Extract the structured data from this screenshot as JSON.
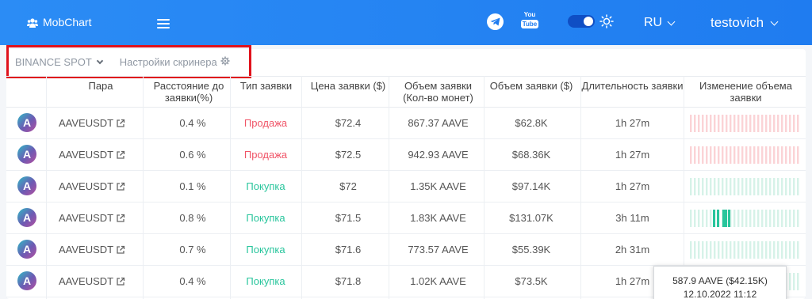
{
  "header": {
    "brand": "MobChart",
    "language": "RU",
    "username": "testovich"
  },
  "toolbar": {
    "exchange": "BINANCE SPOT",
    "settings_label": "Настройки скринера"
  },
  "table": {
    "columns": [
      "Пара",
      "Расстояние до заявки(%)",
      "Тип заявки",
      "Цена заявки ($)",
      "Объем заявки (Кол-во монет)",
      "Объем заявки ($)",
      "Длительность заявки",
      "Изменение объема заявки"
    ],
    "rows": [
      {
        "coin": "A",
        "pair": "AAVEUSDT",
        "distance": "0.4 %",
        "type": "Продажа",
        "side": "sell",
        "price": "$72.4",
        "volume_coins": "867.37 AAVE",
        "volume_usd": "$62.8K",
        "duration": "1h 27m"
      },
      {
        "coin": "A",
        "pair": "AAVEUSDT",
        "distance": "0.6 %",
        "type": "Продажа",
        "side": "sell",
        "price": "$72.5",
        "volume_coins": "942.93 AAVE",
        "volume_usd": "$68.36K",
        "duration": "1h 27m"
      },
      {
        "coin": "A",
        "pair": "AAVEUSDT",
        "distance": "0.1 %",
        "type": "Покупка",
        "side": "buy",
        "price": "$72",
        "volume_coins": "1.35K AAVE",
        "volume_usd": "$97.14K",
        "duration": "1h 27m"
      },
      {
        "coin": "A",
        "pair": "AAVEUSDT",
        "distance": "0.8 %",
        "type": "Покупка",
        "side": "buy",
        "price": "$71.5",
        "volume_coins": "1.83K AAVE",
        "volume_usd": "$131.07K",
        "duration": "3h 11m"
      },
      {
        "coin": "A",
        "pair": "AAVEUSDT",
        "distance": "0.7 %",
        "type": "Покупка",
        "side": "buy",
        "price": "$71.6",
        "volume_coins": "773.57 AAVE",
        "volume_usd": "$55.39K",
        "duration": "2h 31m"
      },
      {
        "coin": "A",
        "pair": "AAVEUSDT",
        "distance": "0.4 %",
        "type": "Покупка",
        "side": "buy",
        "price": "$71.8",
        "volume_coins": "1.02K AAVE",
        "volume_usd": "$73.5K",
        "duration": "1h 27m"
      }
    ]
  },
  "tooltip": {
    "line1": "587.9 AAVE ($42.15K)",
    "line2": "12.10.2022 11:12"
  },
  "colors": {
    "header": "#1f7cf0",
    "sell": "#f05467",
    "buy": "#28c59c",
    "highlight": "#e0121c"
  }
}
